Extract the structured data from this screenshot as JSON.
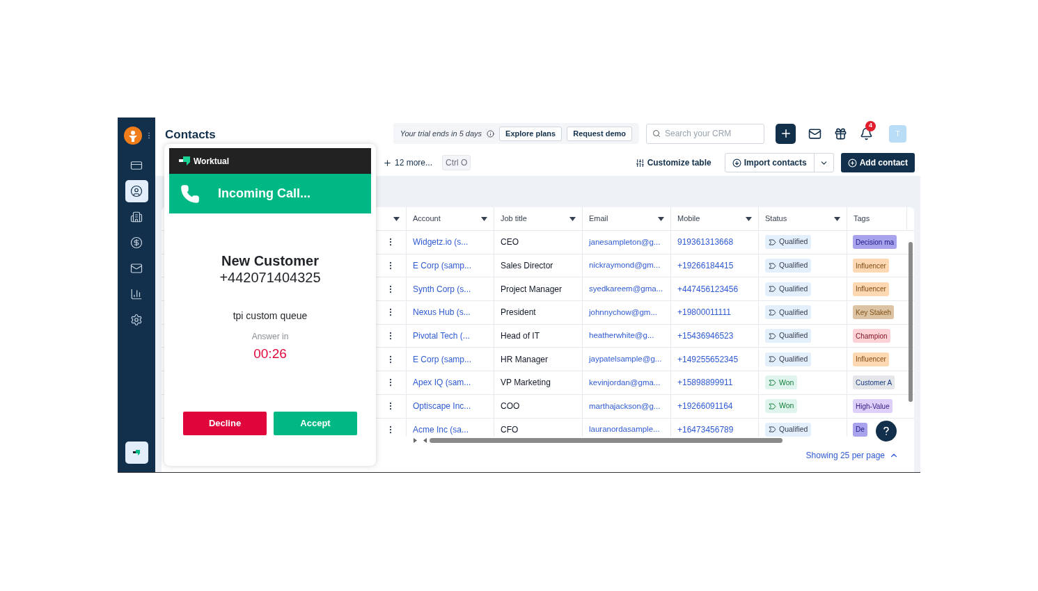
{
  "sidebar": {
    "items": [
      {
        "selected": false
      },
      {
        "selected": true
      },
      {
        "selected": false
      },
      {
        "selected": false
      },
      {
        "selected": false
      },
      {
        "selected": false
      },
      {
        "selected": false
      }
    ]
  },
  "header": {
    "title": "Contacts",
    "trial": {
      "text": "Your trial ends in 5 days",
      "buttons": [
        "Explore plans",
        "Request demo"
      ]
    },
    "search": {
      "placeholder": "Search your CRM"
    },
    "notifications": "4",
    "avatar": "T"
  },
  "toolbar": {
    "more": "12 more...",
    "shortcut": "Ctrl O",
    "customize": "Customize table",
    "import": "Import contacts",
    "add": "Add contact"
  },
  "table": {
    "columns": [
      {
        "menu": true
      },
      {
        "label": "Account",
        "menu": true
      },
      {
        "label": "Job title",
        "menu": true
      },
      {
        "label": "Email",
        "menu": true
      },
      {
        "label": "Mobile",
        "menu": true
      },
      {
        "label": "Status",
        "menu": true
      },
      {
        "label": "Tags",
        "menu": false
      }
    ],
    "rows": [
      {
        "account": "Widgetz.io (s...",
        "job_title": "CEO",
        "email": "janesampleton@g...",
        "mobile": "919361313668",
        "status": {
          "label": "Qualified",
          "kind": "qualified"
        },
        "tag": {
          "label": "Decision ma",
          "color": "#a9a3ee"
        }
      },
      {
        "account": "E Corp (samp...",
        "job_title": "Sales Director",
        "email": "nickraymond@gm...",
        "mobile": "+19266184415",
        "status": {
          "label": "Qualified",
          "kind": "qualified"
        },
        "tag": {
          "label": "Influencer",
          "color": "#fdd8b2"
        }
      },
      {
        "account": "Synth Corp (s...",
        "job_title": "Project Manager",
        "email": "syedkareem@gma...",
        "mobile": "+447456123456",
        "status": {
          "label": "Qualified",
          "kind": "qualified"
        },
        "tag": {
          "label": "Influencer",
          "color": "#fdd8b2"
        }
      },
      {
        "account": "Nexus Hub (s...",
        "job_title": "President",
        "email": "johnnychow@gm...",
        "mobile": "+19800011111",
        "status": {
          "label": "Qualified",
          "kind": "qualified"
        },
        "tag": {
          "label": "Key Stakeh",
          "color": "#dcc3a4"
        }
      },
      {
        "account": "Pivotal Tech (...",
        "job_title": "Head of IT",
        "email": "heatherwhite@g...",
        "mobile": "+15436946523",
        "status": {
          "label": "Qualified",
          "kind": "qualified"
        },
        "tag": {
          "label": "Champion",
          "color": "#fcd2d6"
        }
      },
      {
        "account": "E Corp (samp...",
        "job_title": "HR Manager",
        "email": "jaypatelsample@g...",
        "mobile": "+149255652345",
        "status": {
          "label": "Qualified",
          "kind": "qualified"
        },
        "tag": {
          "label": "Influencer",
          "color": "#fdd8b2"
        }
      },
      {
        "account": "Apex IQ (sam...",
        "job_title": "VP Marketing",
        "email": "kevinjordan@gma...",
        "mobile": "+15898899911",
        "status": {
          "label": "Won",
          "kind": "won"
        },
        "tag": {
          "label": "Customer A",
          "color": "#e4e6ea"
        }
      },
      {
        "account": "Optiscape Inc...",
        "job_title": "COO",
        "email": "marthajackson@g...",
        "mobile": "+19266091164",
        "status": {
          "label": "Won",
          "kind": "won"
        },
        "tag": {
          "label": "High-Value",
          "color": "#dcd0fa"
        }
      },
      {
        "account": "Acme Inc (sa...",
        "job_title": "CFO",
        "email": "lauranordasample...",
        "mobile": "+16473456789",
        "status": {
          "label": "Qualified",
          "kind": "qualified"
        },
        "tag": {
          "label": "De",
          "color": "#a9a3ee"
        }
      }
    ]
  },
  "footer": {
    "pagination": "Showing 25 per page"
  },
  "call_popup": {
    "brand": "Worktual",
    "banner": "Incoming Call...",
    "caller": "New Customer",
    "number": "+442071404325",
    "queue": "tpi custom queue",
    "countdown_label": "Answer in",
    "countdown": "00:26",
    "buttons": [
      {
        "label": "Decline",
        "kind": "decline"
      },
      {
        "label": "Accept",
        "kind": "accept"
      }
    ]
  }
}
